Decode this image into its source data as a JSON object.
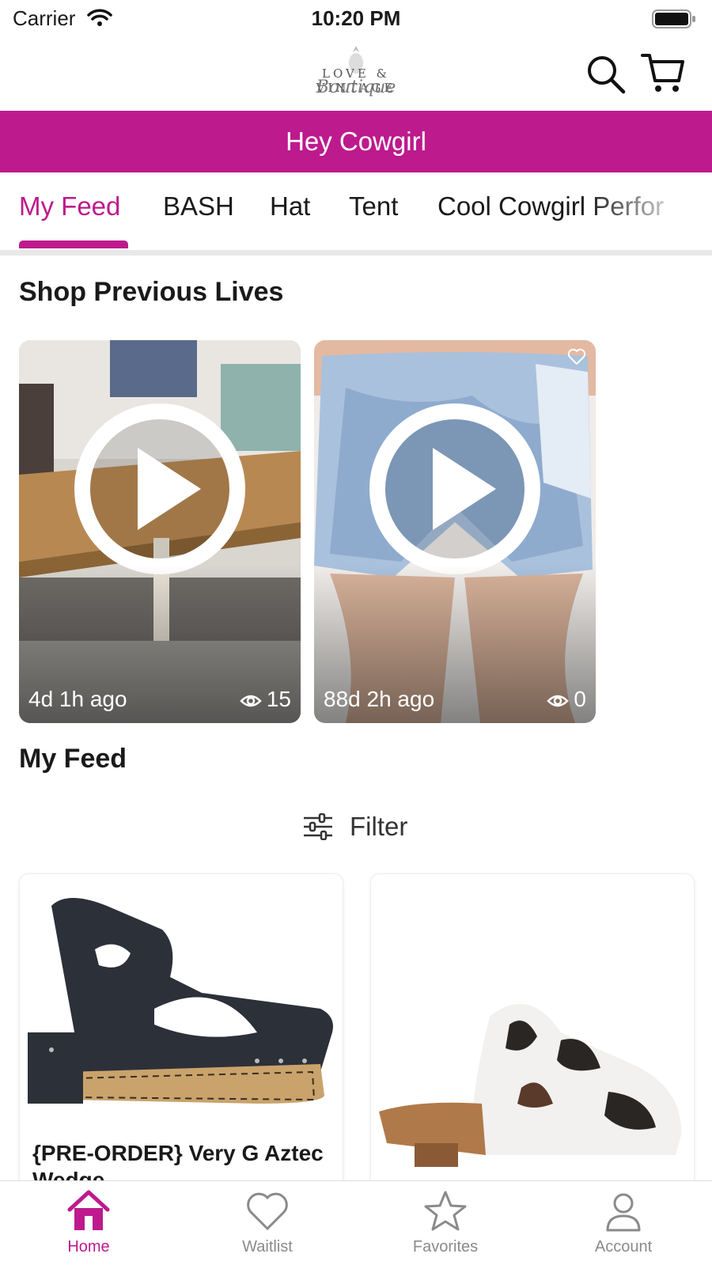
{
  "status_bar": {
    "carrier": "Carrier",
    "time": "10:20 PM"
  },
  "header": {
    "logo_top": "LOVE & VINTAGE",
    "logo_script": "Boutique"
  },
  "banner": {
    "text": "Hey Cowgirl"
  },
  "tabs": [
    {
      "label": "My Feed",
      "active": true
    },
    {
      "label": "BASH"
    },
    {
      "label": "Hat"
    },
    {
      "label": "Tent"
    },
    {
      "label": "Cool Cowgirl Perfor"
    }
  ],
  "previous_lives": {
    "title": "Shop Previous Lives",
    "items": [
      {
        "ago": "4d 1h ago",
        "views": "15"
      },
      {
        "ago": "88d 2h ago",
        "views": "0"
      }
    ]
  },
  "feed": {
    "title": "My Feed",
    "filter_label": "Filter",
    "products": [
      {
        "title": "{PRE-ORDER} Very G Aztec Wedge"
      },
      {
        "title": ""
      }
    ]
  },
  "tabbar": [
    {
      "label": "Home",
      "icon": "home-icon",
      "active": true
    },
    {
      "label": "Waitlist",
      "icon": "heart-icon"
    },
    {
      "label": "Favorites",
      "icon": "star-icon"
    },
    {
      "label": "Account",
      "icon": "person-icon"
    }
  ],
  "colors": {
    "accent": "#bd1a8d"
  }
}
